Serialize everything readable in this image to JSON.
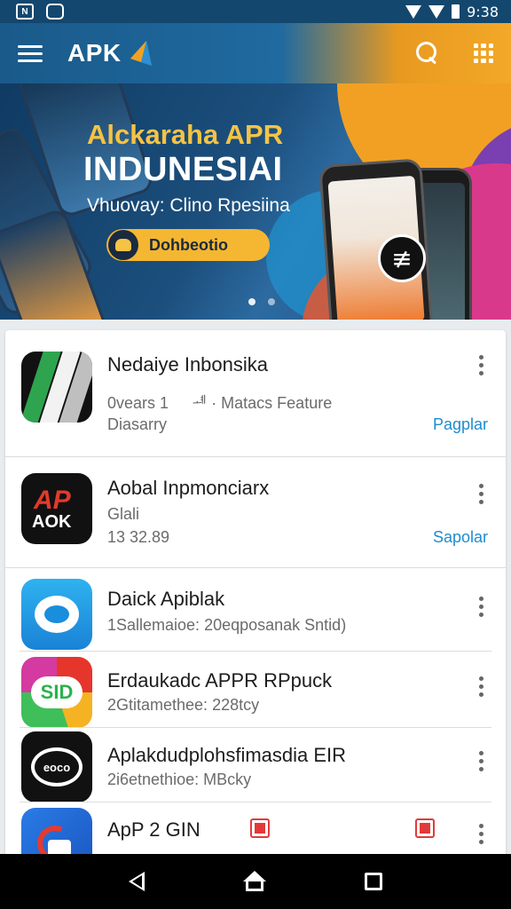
{
  "status_bar": {
    "time": "9:38",
    "left_icons": [
      "notification-icon",
      "photo-icon"
    ]
  },
  "app_bar": {
    "logo_text": "APK",
    "icons": [
      "menu-icon",
      "search-icon",
      "grid-icon"
    ]
  },
  "banner": {
    "title_line1": "Alckaraha APR",
    "title_line2": "INDUNESIAI",
    "subtitle": "Vhuovay: Clino Rpesiina",
    "button_label": "Dohbeotio",
    "center_glyph": "≢",
    "page_count": 2,
    "active_page": 1
  },
  "apps": [
    {
      "name": "Nedaiye Inbonsika",
      "line2": "0vears 1 ᅟ ᆁ · Matacs Feature",
      "line3": "Diasarry",
      "action": "Pagplar",
      "icon": "w-logo-icon"
    },
    {
      "name": "Aobal Inpmonciarx",
      "line2": "Glali",
      "line3": "13 32.89",
      "action": "Sapolar",
      "icon": "apk-logo-icon"
    },
    {
      "name": "Daick Apiblak",
      "line2": "1Sallemaioe: 20eqposanak Sntid)",
      "line3": "",
      "action": "",
      "icon": "chat-bubble-icon"
    },
    {
      "name": "Erdaukadc APPR RPpuck",
      "line2": "2Gtitamethee: 228tcy",
      "line3": "",
      "action": "",
      "icon": "sid-logo-icon"
    },
    {
      "name": "Aplakdudplohsfimasdia EIR",
      "line2": "2i6etnethioe: MBcky",
      "line3": "",
      "action": "",
      "icon": "speech-logo-icon"
    },
    {
      "name": "ApP 2 GIN",
      "line2": "",
      "line3": "",
      "action": "",
      "icon": "refresh-logo-icon"
    }
  ],
  "colors": {
    "accent": "#1e8cd0",
    "status_bar": "#14476e",
    "banner_button": "#f5b731"
  },
  "nav": {
    "icons": [
      "back-icon",
      "home-icon",
      "recents-icon"
    ]
  }
}
